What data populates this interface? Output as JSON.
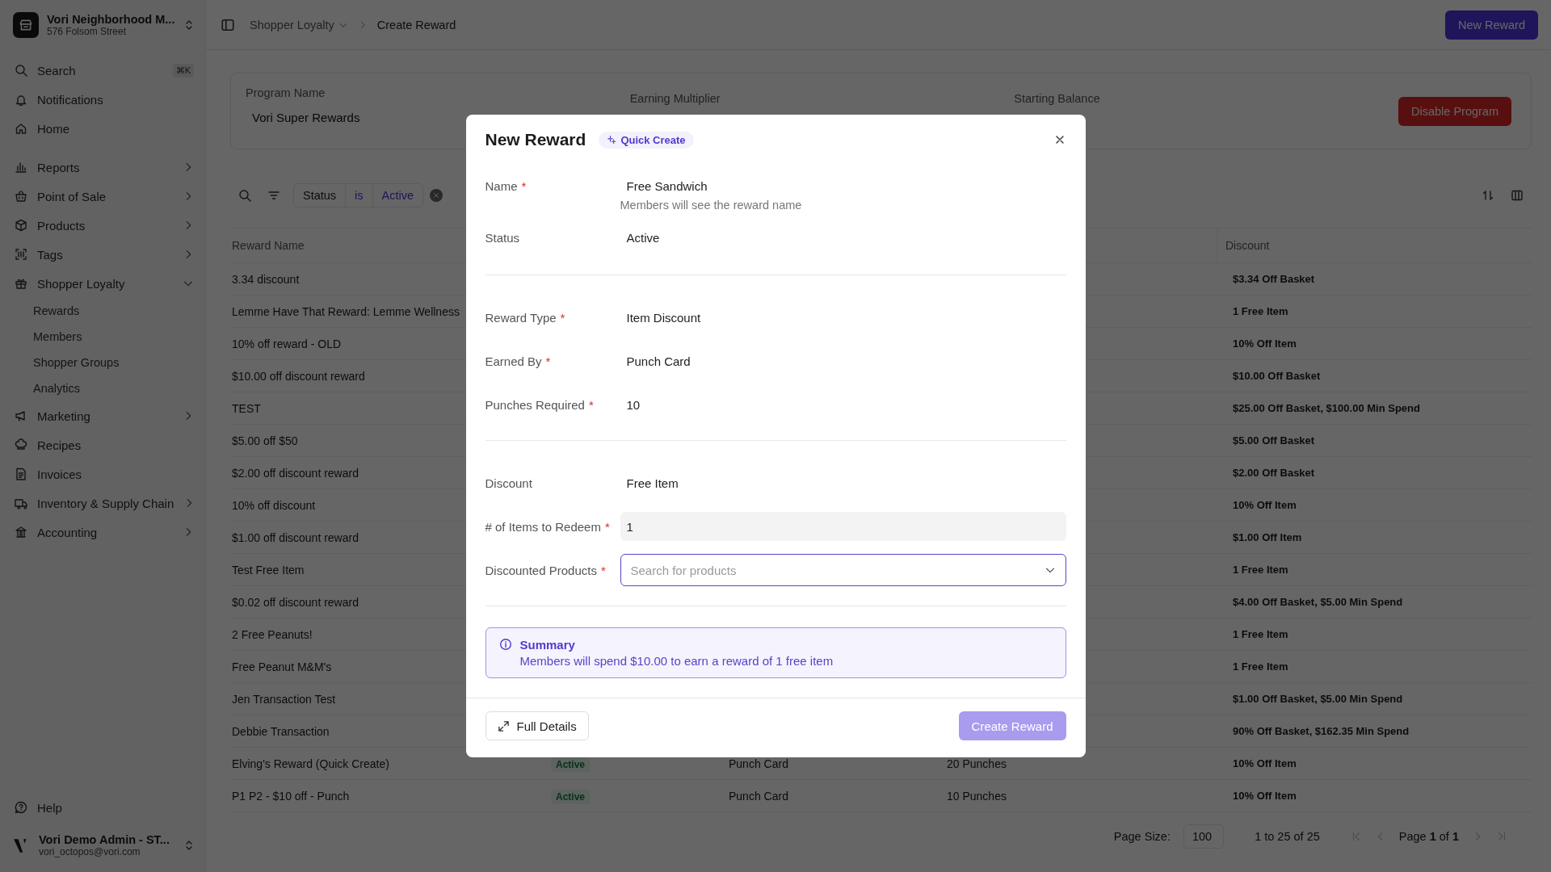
{
  "sidebar": {
    "store": {
      "name": "Vori Neighborhood M...",
      "address": "576 Folsom Street"
    },
    "search": {
      "label": "Search",
      "shortcut": "⌘K"
    },
    "nav": [
      {
        "items": [
          {
            "label": "Notifications",
            "kind": "link"
          },
          {
            "label": "Home",
            "kind": "link"
          }
        ]
      },
      {
        "items": [
          {
            "label": "Reports",
            "kind": "group",
            "expanded": false
          },
          {
            "label": "Point of Sale",
            "kind": "group",
            "expanded": false
          },
          {
            "label": "Products",
            "kind": "group",
            "expanded": false
          },
          {
            "label": "Tags",
            "kind": "group",
            "expanded": false
          },
          {
            "label": "Shopper Loyalty",
            "kind": "group",
            "expanded": true,
            "children": [
              {
                "label": "Rewards"
              },
              {
                "label": "Members"
              },
              {
                "label": "Shopper Groups"
              },
              {
                "label": "Analytics"
              }
            ]
          },
          {
            "label": "Marketing",
            "kind": "group",
            "expanded": false
          },
          {
            "label": "Recipes",
            "kind": "link"
          },
          {
            "label": "Invoices",
            "kind": "link"
          },
          {
            "label": "Inventory & Supply Chain",
            "kind": "group",
            "expanded": false
          },
          {
            "label": "Accounting",
            "kind": "group",
            "expanded": false
          }
        ]
      }
    ],
    "help": "Help",
    "user": {
      "name": "Vori Demo Admin - ST...",
      "email": "vori_octopos@vori.com"
    }
  },
  "topbar": {
    "breadcrumb": [
      {
        "label": "Shopper Loyalty",
        "dropdown": true
      },
      {
        "label": "Create Reward",
        "dropdown": false
      }
    ],
    "button": "New Reward"
  },
  "program": {
    "fields": [
      {
        "label": "Program Name",
        "value": "Vori Super Rewards"
      },
      {
        "label": "Earning Multiplier"
      },
      {
        "label": "Starting Balance"
      }
    ],
    "button": "Disable Program"
  },
  "filters": {
    "chips": [
      "Status",
      "is",
      "Active"
    ]
  },
  "table": {
    "columns": [
      "Reward Name",
      "Discount"
    ],
    "rows": [
      {
        "name": "3.34 discount",
        "discount": "$3.34 Off Basket"
      },
      {
        "name": "Lemme Have That Reward: Lemme Wellness",
        "discount": "1 Free Item"
      },
      {
        "name": "10% off reward - OLD",
        "discount": "10% Off Item"
      },
      {
        "name": "$10.00 off discount reward",
        "discount": "$10.00 Off Basket"
      },
      {
        "name": "TEST",
        "discount": "$25.00 Off Basket, $100.00 Min Spend"
      },
      {
        "name": "$5.00 off $50",
        "discount": "$5.00 Off Basket"
      },
      {
        "name": "$2.00 off discount reward",
        "discount": "$2.00 Off Basket"
      },
      {
        "name": "10% off discount",
        "discount": "10% Off Item"
      },
      {
        "name": "$1.00 off discount reward",
        "discount": "$1.00 Off Item"
      },
      {
        "name": "Test Free Item",
        "discount": "1 Free Item"
      },
      {
        "name": "$0.02 off discount reward",
        "discount": "$4.00 Off Basket, $5.00 Min Spend"
      },
      {
        "name": "2 Free Peanuts!",
        "discount": "1 Free Item"
      },
      {
        "name": "Free Peanut M&M's",
        "discount": "1 Free Item"
      },
      {
        "name": "Jen Transaction Test",
        "discount": "$1.00 Off Basket, $5.00 Min Spend"
      },
      {
        "name": "Debbie Transaction",
        "discount": "90% Off Basket, $162.35 Min Spend"
      },
      {
        "name": "Elving's Reward (Quick Create)",
        "column_2": "Active",
        "column_3": "Punch Card",
        "column_4": "20 Punches",
        "discount": "10% Off Item"
      },
      {
        "name": "P1 P2 - $10 off - Punch",
        "column_2": "Active",
        "column_3": "Punch Card",
        "column_4": "10 Punches",
        "discount": "10% Off Item"
      }
    ]
  },
  "pager": {
    "page_size_label": "Page Size:",
    "page_size": "100",
    "range": "1 to 25 of 25",
    "page": "Page **1** of **1**"
  },
  "modal": {
    "title": "New Reward",
    "badge": "Quick Create",
    "required_mark": "*",
    "sections": [
      [
        {
          "kind": "text",
          "label": "Name",
          "required": true,
          "value": "Free Sandwich",
          "hint": "Members will see the reward name"
        },
        {
          "kind": "text",
          "label": "Status",
          "required": false,
          "value": "Active"
        }
      ],
      [
        {
          "kind": "text",
          "label": "Reward Type",
          "required": true,
          "value": "Item Discount"
        },
        {
          "kind": "text",
          "label": "Earned By",
          "required": true,
          "value": "Punch Card"
        },
        {
          "kind": "text",
          "label": "Punches Required",
          "required": true,
          "value": "10"
        }
      ],
      [
        {
          "kind": "text",
          "label": "Discount",
          "required": false,
          "value": "Free Item"
        },
        {
          "kind": "input",
          "label": "# of Items to Redeem",
          "required": true,
          "value": "1"
        },
        {
          "kind": "select",
          "label": "Discounted Products",
          "required": true,
          "placeholder": "Search for products"
        }
      ]
    ],
    "summary": {
      "title": "Summary",
      "text": "Members will spend $10.00 to earn a reward of 1 free item"
    },
    "secondary_button": "Full Details",
    "primary_button": {
      "label": "Create Reward",
      "disabled": true
    }
  }
}
